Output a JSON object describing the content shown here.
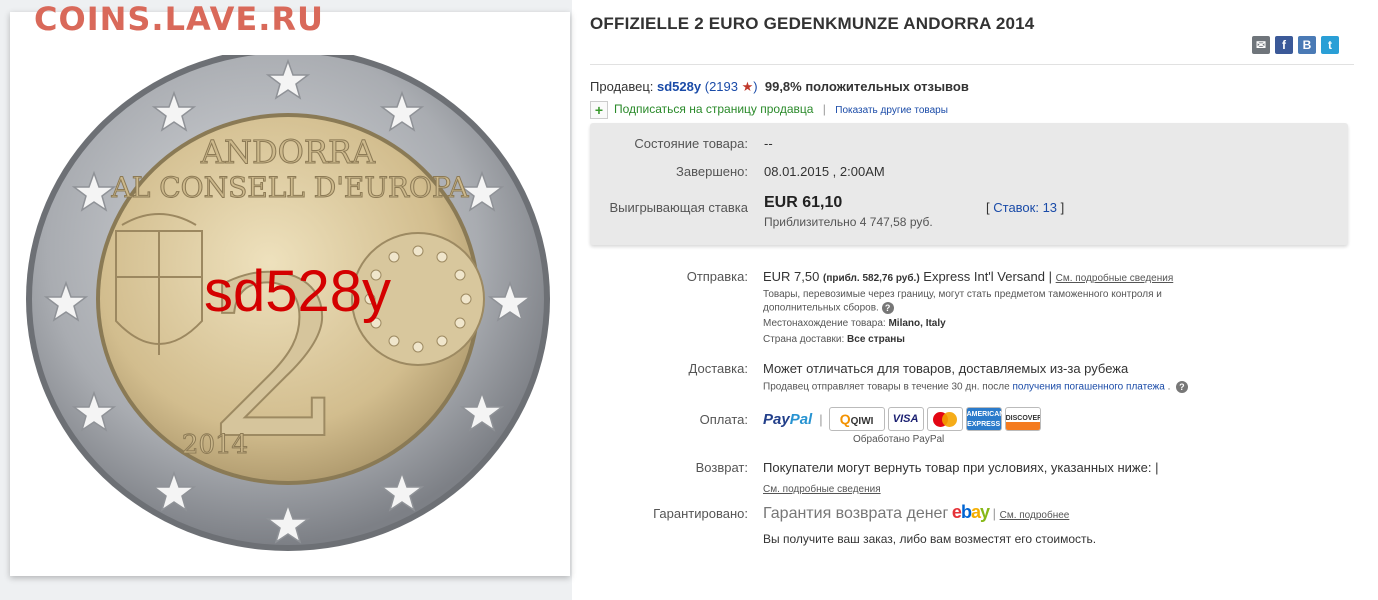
{
  "watermark": {
    "site": "COINS.LAVE.RU",
    "seller": "sd528y"
  },
  "coin": {
    "line1": "ANDORRA",
    "line2": "AL CONSELL D'EUROPA",
    "denomination": "2",
    "year": "2014"
  },
  "listing": {
    "title": "OFFIZIELLE 2 EURO GEDENKMUNZE ANDORRA 2014"
  },
  "share_icons": [
    "mail-icon",
    "facebook-icon",
    "blog-icon",
    "twitter-icon"
  ],
  "seller": {
    "label": "Продавец:",
    "name": "sd528y",
    "open_paren": "(",
    "count": "2193",
    "close_paren": ")",
    "star": "★",
    "feedback": "99,8% положительных отзывов",
    "follow_icon": "+",
    "follow": "Подписаться на страницу продавца",
    "separator": "|",
    "other_items": "Показать другие товары"
  },
  "details": {
    "condition_label": "Состояние товара:",
    "condition_value": "--",
    "ended_label": "Завершено:",
    "ended_value": "08.01.2015 , 2:00AM",
    "winning_label": "Выигрывающая ставка",
    "winning_price": "EUR 61,10",
    "winning_approx": "Приблизительно 4 747,58 руб.",
    "bids_open": "[",
    "bids_link": "Ставок: 13",
    "bids_close": "]"
  },
  "shipping": {
    "label": "Отправка:",
    "price": "EUR 7,50",
    "approx": "(прибл. 582,76 руб.)",
    "service": "Express Int'l Versand",
    "sep": "|",
    "details_link": "См. подробные сведения",
    "customs_note_1": "Товары, перевозимые через границу, могут стать предметом таможенного контроля и",
    "customs_note_2": "дополнительных сборов.",
    "location_label": "Местонахождение товара:",
    "location_value": "Milano, Italy",
    "ships_to_label": "Страна доставки:",
    "ships_to_value": "Все страны"
  },
  "delivery": {
    "label": "Доставка:",
    "text": "Может отличаться для товаров, доставляемых из-за рубежа",
    "note_prefix": "Продавец отправляет товары в течение 30 дн. после",
    "note_link": "получения погашенного платежа",
    "note_suffix": "."
  },
  "payment": {
    "label": "Оплата:",
    "paypal_1": "Pay",
    "paypal_2": "Pal",
    "sep": "|",
    "methods": [
      "QIWI",
      "VISA",
      "MasterCard",
      "AMERICAN EXPRESS",
      "DISCOVER"
    ],
    "processed": "Обработано PayPal"
  },
  "returns": {
    "label": "Возврат:",
    "text": "Покупатели могут вернуть товар при условиях, указанных ниже:",
    "sep": "|",
    "link": "См. подробные сведения"
  },
  "guarantee": {
    "label": "Гарантировано:",
    "text": "Гарантия возврата денег",
    "ebay": [
      "e",
      "b",
      "a",
      "y"
    ],
    "sep": "|",
    "link": "См. подробнее",
    "note": "Вы получите ваш заказ, либо вам возместят его стоимость."
  },
  "colors": {
    "link": "#1a4ba8",
    "seller_watermark": "#d40000",
    "site_watermark": "#d9695a",
    "detail_box": "#e9e9e9"
  }
}
